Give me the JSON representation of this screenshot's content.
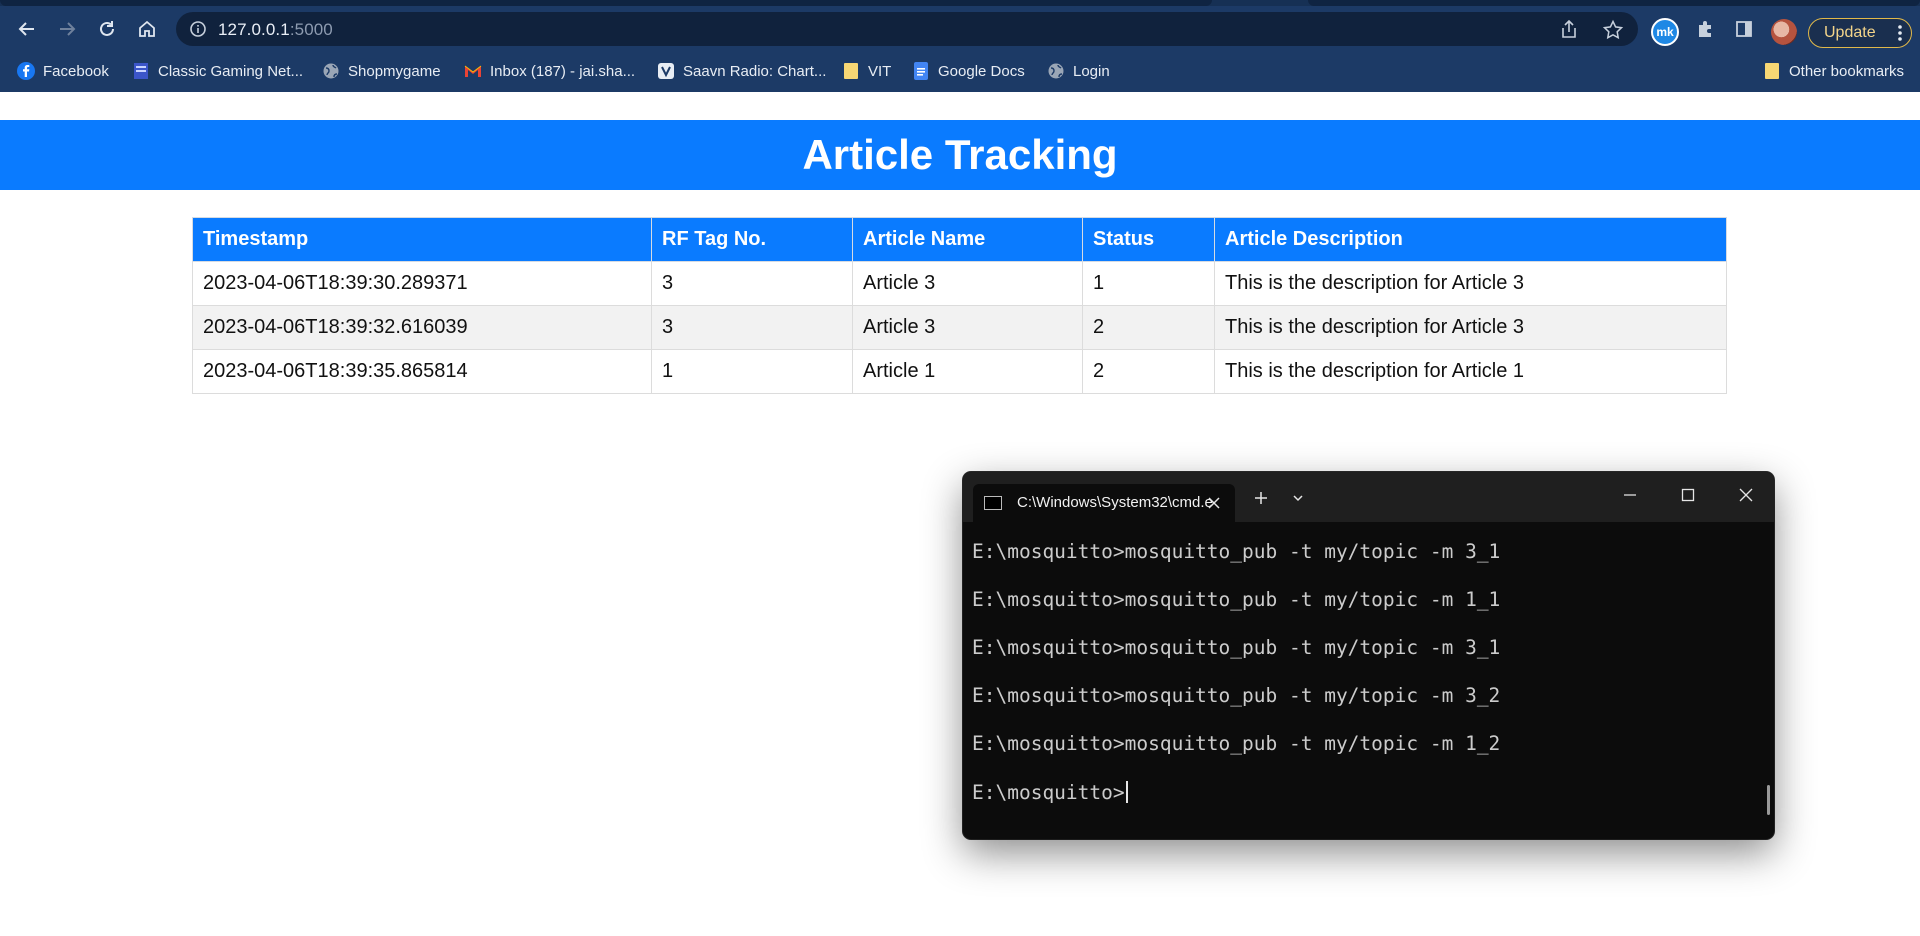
{
  "browser": {
    "url_host": "127.0.0.1",
    "url_port": ":5000",
    "update_label": "Update",
    "extension_badge": "mk",
    "bookmarks": [
      {
        "label": "Facebook",
        "icon": "facebook-icon"
      },
      {
        "label": "Classic Gaming Net...",
        "icon": "page-icon"
      },
      {
        "label": "Shopmygame",
        "icon": "globe-icon"
      },
      {
        "label": "Inbox (187) - jai.sha...",
        "icon": "gmail-icon"
      },
      {
        "label": "Saavn Radio: Chart...",
        "icon": "saavn-icon"
      },
      {
        "label": "VIT",
        "icon": "folder-icon"
      },
      {
        "label": "Google Docs",
        "icon": "docs-icon"
      },
      {
        "label": "Login",
        "icon": "globe-icon"
      }
    ],
    "other_bookmarks": "Other bookmarks",
    "colors": {
      "chrome": "#1c3a66",
      "omnibox": "#10223d",
      "update_border": "#e0b84a"
    }
  },
  "page": {
    "title": "Article Tracking",
    "colors": {
      "header": "#0a7bff",
      "row_alt": "#f2f2f2"
    },
    "table": {
      "headers": [
        "Timestamp",
        "RF Tag No.",
        "Article Name",
        "Status",
        "Article Description"
      ],
      "rows": [
        [
          "2023-04-06T18:39:30.289371",
          "3",
          "Article 3",
          "1",
          "This is the description for Article 3"
        ],
        [
          "2023-04-06T18:39:32.616039",
          "3",
          "Article 3",
          "2",
          "This is the description for Article 3"
        ],
        [
          "2023-04-06T18:39:35.865814",
          "1",
          "Article 1",
          "2",
          "This is the description for Article 1"
        ]
      ]
    }
  },
  "terminal": {
    "tab_title": "C:\\Windows\\System32\\cmd.e",
    "lines": [
      "E:\\mosquitto>mosquitto_pub -t my/topic -m 3_1",
      "E:\\mosquitto>mosquitto_pub -t my/topic -m 1_1",
      "E:\\mosquitto>mosquitto_pub -t my/topic -m 3_1",
      "E:\\mosquitto>mosquitto_pub -t my/topic -m 3_2",
      "E:\\mosquitto>mosquitto_pub -t my/topic -m 1_2"
    ],
    "prompt": "E:\\mosquitto>"
  }
}
